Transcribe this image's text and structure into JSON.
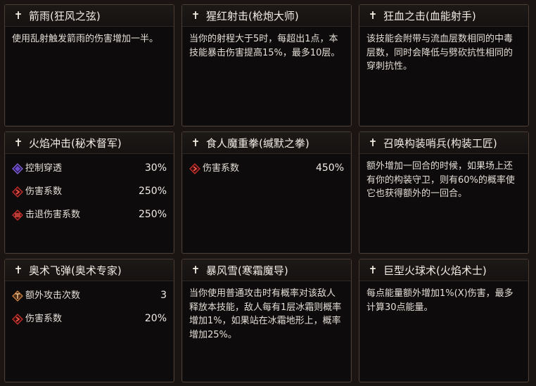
{
  "cards": [
    {
      "title": "箭雨(狂风之弦)",
      "desc": "使用乱射触发箭雨的伤害增加一半。"
    },
    {
      "title": "猩红射击(枪炮大师)",
      "desc": "当你的射程大于5时，每超出1点，本技能暴击伤害提高15%，最多10层。"
    },
    {
      "title": "狂血之击(血能射手)",
      "desc": "该技能会附带与流血层数相同的中毒层数，同时会降低与劈砍抗性相同的穿刺抗性。"
    },
    {
      "title": "火焰冲击(秘术督军)",
      "stats": [
        {
          "icon": "control-penetration-icon",
          "label": "控制穿透",
          "value": "30%"
        },
        {
          "icon": "damage-coefficient-icon",
          "label": "伤害系数",
          "value": "250%"
        },
        {
          "icon": "knockback-damage-icon",
          "label": "击退伤害系数",
          "value": "250%"
        }
      ]
    },
    {
      "title": "食人魔重拳(缄默之拳)",
      "stats": [
        {
          "icon": "damage-coefficient-icon",
          "label": "伤害系数",
          "value": "450%"
        }
      ]
    },
    {
      "title": "召唤构装哨兵(构装工匠)",
      "desc": "额外增加一回合的时候，如果场上还有你的构装守卫，则有60%的概率使它也获得额外的一回合。"
    },
    {
      "title": "奥术飞弹(奥术专家)",
      "stats": [
        {
          "icon": "extra-attack-icon",
          "label": "额外攻击次数",
          "value": "3"
        },
        {
          "icon": "damage-coefficient-icon",
          "label": "伤害系数",
          "value": "20%"
        }
      ]
    },
    {
      "title": "暴风雪(寒霜魔导)",
      "desc": "当你使用普通攻击时有概率对该敌人释放本技能，敌人每有1层冰霜则概率增加1%，如果站在冰霜地形上，概率增加25%。"
    },
    {
      "title": "巨型火球术(火焰术士)",
      "desc": "每点能量额外增加1%(X)伤害，最多计算30点能量。"
    }
  ],
  "colors": {
    "background": "#1a1412",
    "card": "#0d0b0b",
    "border": "#4a3d36",
    "icon_red": "#c8262b",
    "icon_purple": "#7a4fd0",
    "icon_orange": "#c9773a"
  }
}
